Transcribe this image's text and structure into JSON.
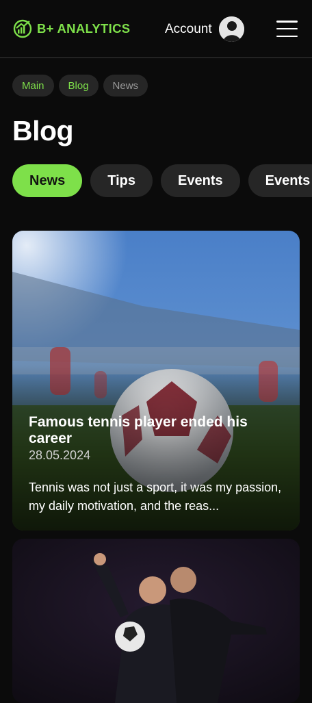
{
  "header": {
    "brand": "B+ ANALYTICS",
    "account_label": "Account",
    "brand_color": "#7ee04a"
  },
  "breadcrumb": [
    "Main",
    "Blog",
    "News"
  ],
  "page_title": "Blog",
  "tabs": [
    {
      "label": "News",
      "active": true
    },
    {
      "label": "Tips",
      "active": false
    },
    {
      "label": "Events",
      "active": false
    },
    {
      "label": "Events",
      "active": false
    }
  ],
  "posts": [
    {
      "title": "Famous tennis player ended his career",
      "date": "28.05.2024",
      "excerpt": "Tennis was not just a sport, it was my passion, my daily motivation, and the reas..."
    }
  ],
  "icons": {
    "logo": "analytics-logo-icon",
    "menu": "hamburger-menu-icon"
  }
}
